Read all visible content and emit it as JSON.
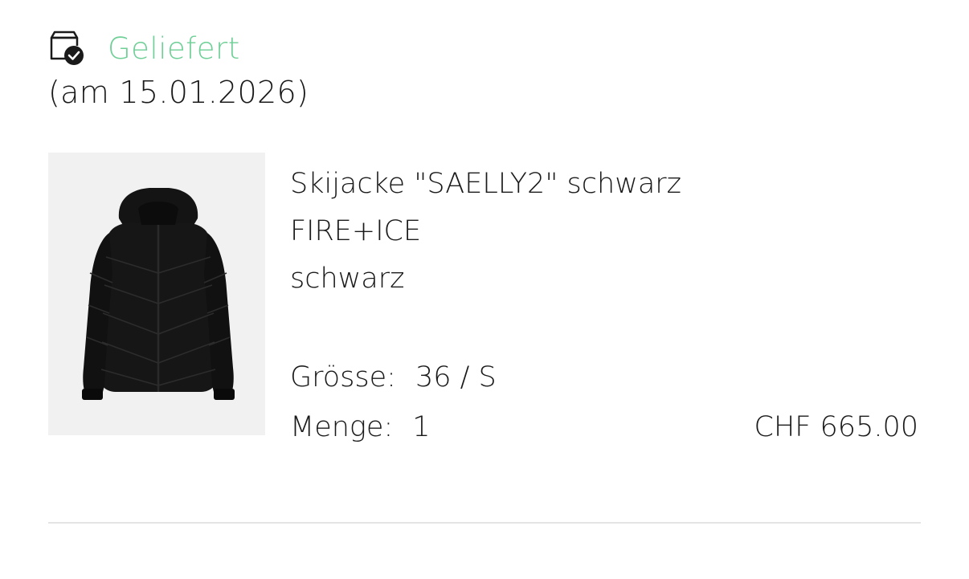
{
  "status": {
    "icon": "package-delivered-icon",
    "label": "Geliefert",
    "color": "#6fcf97"
  },
  "delivery_date": "(am 15.01.2026)",
  "product": {
    "image": "black-ski-jacket-image",
    "name": "Skijacke \"SAELLY2\" schwarz",
    "brand": "FIRE+ICE",
    "color": "schwarz",
    "size_label": "Grösse:",
    "size_value": "36 / S",
    "quantity_label": "Menge:",
    "quantity_value": "1",
    "price": "CHF 665.00"
  }
}
